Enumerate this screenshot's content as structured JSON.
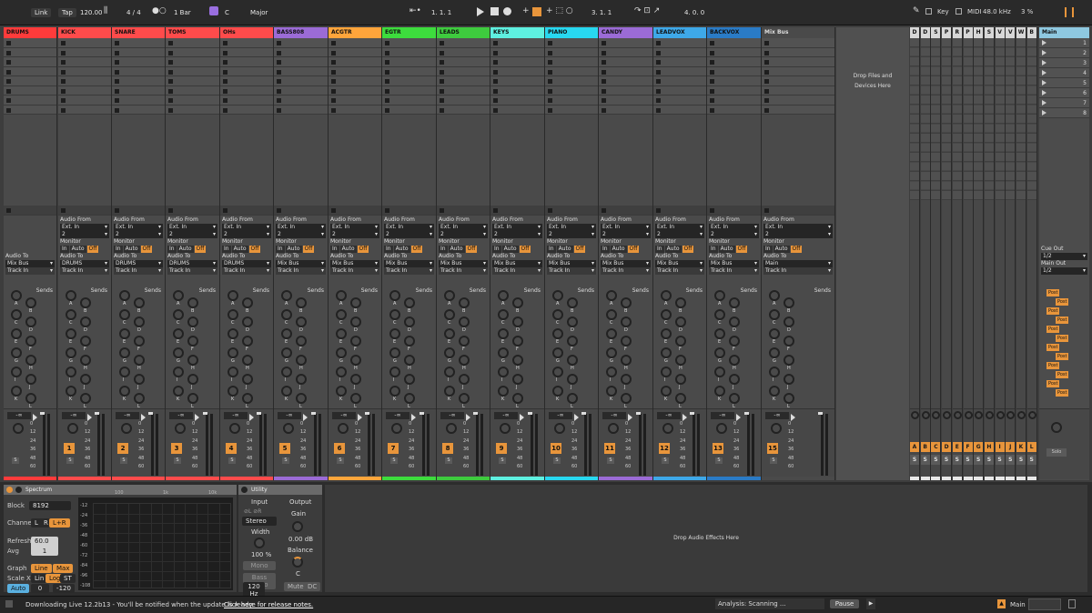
{
  "toolbar": {
    "link": "Link",
    "tap": "Tap",
    "tempo": "120.00",
    "signature": "4 / 4",
    "quantize": "1 Bar",
    "key_root": "C",
    "key_scale": "Major",
    "position": "1.   1.   1",
    "loop_start": "3.   1.   1",
    "loop_len": "4.   0.   0",
    "key": "Key",
    "midi": "MIDI",
    "sample_rate": "48.0 kHz",
    "cpu": "3 %"
  },
  "tracks": [
    {
      "name": "DRUMS",
      "color": "#ff3b3b",
      "audio_from_label": "",
      "audio_from": "",
      "channel": "",
      "output": "Mix Bus",
      "num": "",
      "group": true
    },
    {
      "name": "KICK",
      "color": "#ff4b4b",
      "audio_from_label": "Audio From",
      "audio_from": "Ext. In",
      "channel": "2",
      "output": "DRUMS",
      "num": "1"
    },
    {
      "name": "SNARE",
      "color": "#ff4b4b",
      "audio_from_label": "Audio From",
      "audio_from": "Ext. In",
      "channel": "2",
      "output": "DRUMS",
      "num": "2"
    },
    {
      "name": "TOMS",
      "color": "#ff4b4b",
      "audio_from_label": "Audio From",
      "audio_from": "Ext. In",
      "channel": "2",
      "output": "DRUMS",
      "num": "3"
    },
    {
      "name": "OHs",
      "color": "#ff4b4b",
      "audio_from_label": "Audio From",
      "audio_from": "Ext. In",
      "channel": "2",
      "output": "DRUMS",
      "num": "4"
    },
    {
      "name": "BASS808",
      "color": "#9b6bd6",
      "audio_from_label": "Audio From",
      "audio_from": "Ext. In",
      "channel": "2",
      "output": "Mix Bus",
      "num": "5"
    },
    {
      "name": "ACGTR",
      "color": "#ffa53b",
      "audio_from_label": "Audio From",
      "audio_from": "Ext. In",
      "channel": "2",
      "output": "Mix Bus",
      "num": "6"
    },
    {
      "name": "EGTR",
      "color": "#3ddc3d",
      "audio_from_label": "Audio From",
      "audio_from": "Ext. In",
      "channel": "2",
      "output": "Mix Bus",
      "num": "7"
    },
    {
      "name": "LEADS",
      "color": "#3ecb3e",
      "audio_from_label": "Audio From",
      "audio_from": "Ext. In",
      "channel": "2",
      "output": "Mix Bus",
      "num": "8"
    },
    {
      "name": "KEYS",
      "color": "#5ef0e0",
      "audio_from_label": "Audio From",
      "audio_from": "Ext. In",
      "channel": "2",
      "output": "Mix Bus",
      "num": "9"
    },
    {
      "name": "PIANO",
      "color": "#28d8f0",
      "audio_from_label": "Audio From",
      "audio_from": "Ext. In",
      "channel": "2",
      "output": "Mix Bus",
      "num": "10"
    },
    {
      "name": "CANDY",
      "color": "#9b6bd6",
      "audio_from_label": "Audio From",
      "audio_from": "Ext. In",
      "channel": "2",
      "output": "Mix Bus",
      "num": "11"
    },
    {
      "name": "LEADVOX",
      "color": "#3ea8e8",
      "audio_from_label": "Audio From",
      "audio_from": "Ext. In",
      "channel": "2",
      "output": "Mix Bus",
      "num": "12"
    },
    {
      "name": "BACKVOX",
      "color": "#2a7bc6",
      "audio_from_label": "Audio From",
      "audio_from": "Ext. In",
      "channel": "2",
      "output": "Mix Bus",
      "num": "13"
    },
    {
      "name": "Mix Bus",
      "color": "#4a4a4a",
      "audio_from_label": "Audio From",
      "audio_from": "Ext. In",
      "channel": "2",
      "output": "Main",
      "num": "15"
    }
  ],
  "common": {
    "monitor": "Monitor",
    "in": "In",
    "auto": "Auto",
    "off": "Off",
    "audio_to": "Audio To",
    "track_in": "Track In",
    "sends": "Sends",
    "vol": "-∞",
    "solo": "S",
    "send_letters": [
      "A",
      "B",
      "C",
      "D",
      "E",
      "F",
      "G",
      "H",
      "I",
      "J",
      "K",
      "L"
    ],
    "meter_scale": [
      "0",
      "12",
      "24",
      "36",
      "48",
      "60"
    ]
  },
  "drop_files": "Drop Files and Devices Here",
  "returns": [
    "D",
    "D",
    "S",
    "P",
    "R",
    "P",
    "H",
    "S",
    "V",
    "V",
    "W",
    "B"
  ],
  "return_letters": [
    "A",
    "B",
    "C",
    "D",
    "E",
    "F",
    "G",
    "H",
    "I",
    "J",
    "K",
    "L"
  ],
  "main": {
    "name": "Main",
    "scenes": [
      "1",
      "2",
      "3",
      "4",
      "5",
      "6",
      "7",
      "8"
    ],
    "cue_out_label": "Cue Out",
    "cue_out": "1/2",
    "main_out_label": "Main Out",
    "main_out": "1/2",
    "post": "Post",
    "solo": "Solo"
  },
  "spectrum": {
    "title": "Spectrum",
    "block_label": "Block",
    "block": "8192",
    "channel_label": "Channel",
    "ch_l": "L",
    "ch_r": "R",
    "ch_lr": "L+R",
    "refresh_label": "Refresh",
    "refresh": "60.0 ms",
    "avg_label": "Avg",
    "avg": "1",
    "graph_label": "Graph",
    "graph_line": "Line",
    "graph_max": "Max",
    "scalex_label": "Scale X",
    "scalex_lin": "Lin",
    "scalex_log": "Log",
    "scalex_st": "ST",
    "auto": "Auto",
    "range_lo": "0",
    "range_hi": "-120",
    "freq_ticks": [
      "100",
      "1k",
      "10k"
    ],
    "db_ticks": [
      "-12",
      "-24",
      "-36",
      "-48",
      "-60",
      "-72",
      "-84",
      "-96",
      "-108"
    ]
  },
  "utility": {
    "title": "Utility",
    "input": "Input",
    "output": "Output",
    "mode": "Stereo",
    "width_label": "Width",
    "width": "100 %",
    "mono": "Mono",
    "gain": "Gain",
    "gain_value": "0.00 dB",
    "balance": "Balance",
    "balance_value": "C",
    "bass_mono": "Bass Mono",
    "bass_freq": "120 Hz",
    "mute": "Mute",
    "dc": "DC"
  },
  "drop_effects": "Drop Audio Effects Here",
  "status": {
    "message": "Downloading Live 12.2b13 - You'll be notified when the update is ready.",
    "link": "Click here for release notes.",
    "analysis": "Analysis: Scanning ...",
    "pause": "Pause",
    "main": "Main"
  }
}
